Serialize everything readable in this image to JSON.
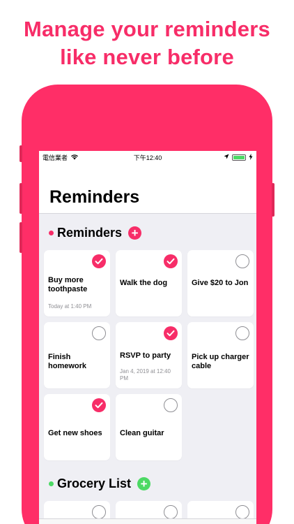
{
  "headline": {
    "line1": "Manage your reminders",
    "line2": "like never before"
  },
  "status_bar": {
    "carrier": "電信業者",
    "time": "下午12:40"
  },
  "nav": {
    "title": "Reminders"
  },
  "colors": {
    "brand": "#f72d68",
    "phone": "#ff2e67",
    "grocery": "#4cd964"
  },
  "sections": [
    {
      "title": "Reminders",
      "dot_color": "#f72d68",
      "add_label": "+",
      "cards": [
        {
          "title": "Buy more toothpaste",
          "time": "Today at 1:40 PM",
          "done": true
        },
        {
          "title": "Walk the dog",
          "time": "",
          "done": true
        },
        {
          "title": "Give $20 to Jon",
          "time": "",
          "done": false
        },
        {
          "title": "Finish homework",
          "time": "",
          "done": false
        },
        {
          "title": "RSVP to party",
          "time": "Jan 4, 2019 at 12:40 PM",
          "done": true
        },
        {
          "title": "Pick up charger cable",
          "time": "",
          "done": false
        },
        {
          "title": "Get new shoes",
          "time": "",
          "done": true
        },
        {
          "title": "Clean guitar",
          "time": "",
          "done": false
        }
      ]
    },
    {
      "title": "Grocery List",
      "dot_color": "#4cd964",
      "add_label": "+"
    }
  ]
}
